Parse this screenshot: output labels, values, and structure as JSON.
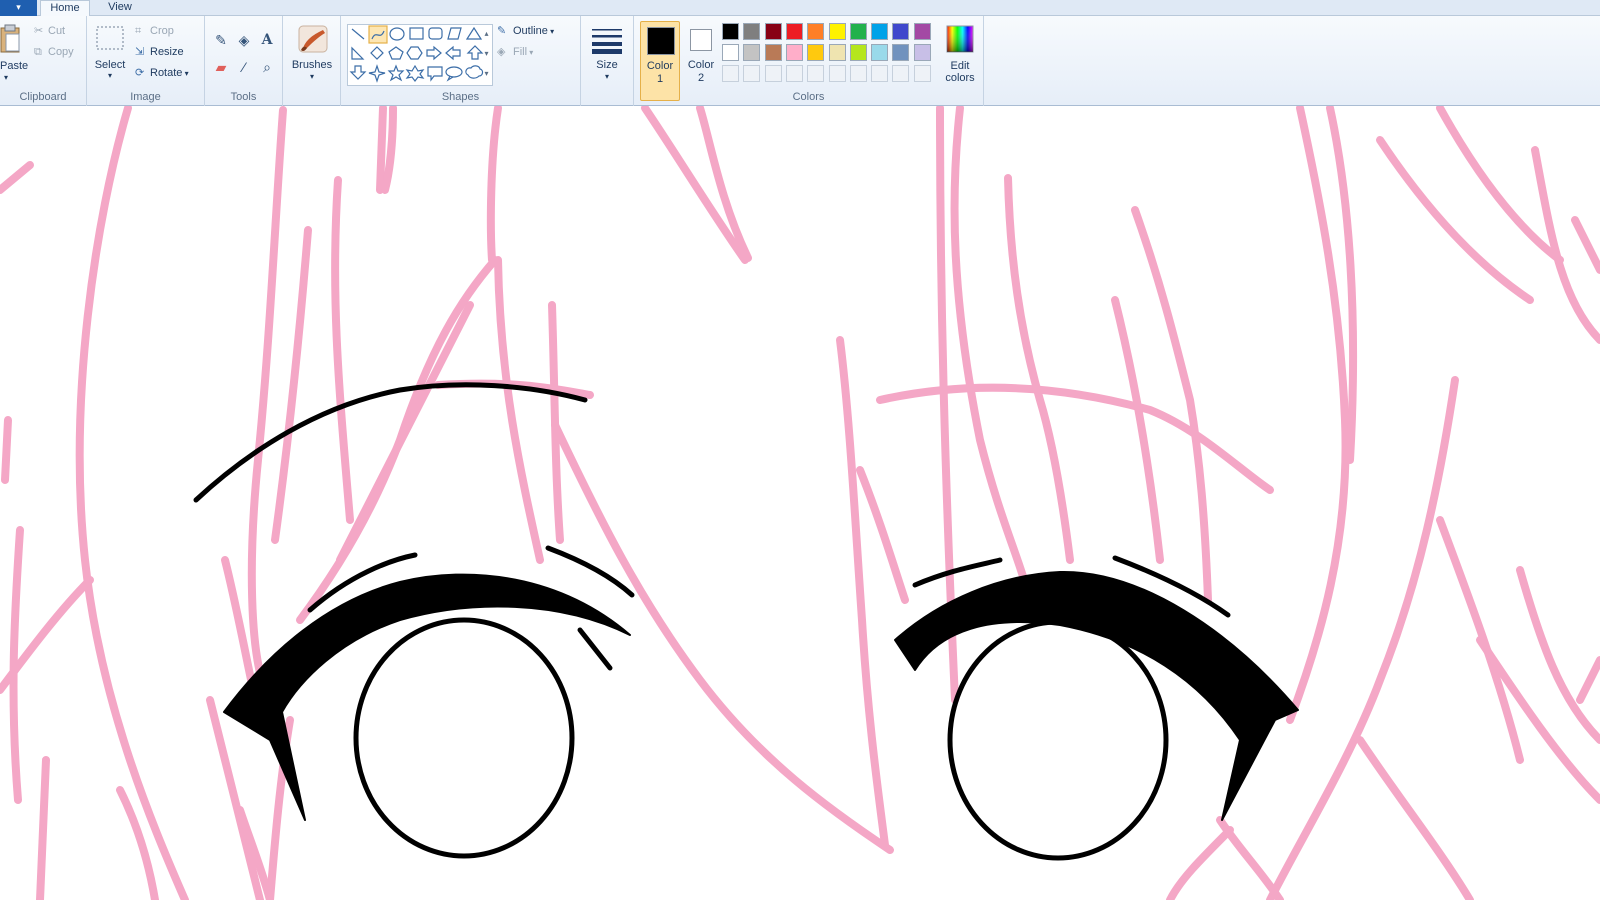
{
  "tabs": {
    "file_label": "▾",
    "home": "Home",
    "view": "View"
  },
  "clipboard": {
    "paste": "Paste",
    "cut": "Cut",
    "copy": "Copy",
    "group": "Clipboard"
  },
  "image": {
    "select": "Select",
    "crop": "Crop",
    "resize": "Resize",
    "rotate": "Rotate",
    "group": "Image"
  },
  "tools": {
    "group": "Tools",
    "icons": [
      "pencil-icon",
      "fill-icon",
      "text-icon",
      "eraser-icon",
      "color-picker-icon",
      "magnifier-icon"
    ]
  },
  "brushes": {
    "label": "Brushes"
  },
  "shapes": {
    "group": "Shapes",
    "outline": "Outline",
    "fill": "Fill"
  },
  "size": {
    "label": "Size"
  },
  "color1": {
    "label": "Color",
    "sub": "1",
    "value": "#000000"
  },
  "color2": {
    "label": "Color",
    "sub": "2",
    "value": "#ffffff"
  },
  "colors": {
    "group": "Colors",
    "edit": "Edit",
    "edit_sub": "colors",
    "row1": [
      "#000000",
      "#7f7f7f",
      "#880015",
      "#ed1c24",
      "#ff7f27",
      "#fff200",
      "#22b14c",
      "#00a2e8",
      "#3f48cc",
      "#a349a4"
    ],
    "row2": [
      "#ffffff",
      "#c3c3c3",
      "#b97a57",
      "#ffaec9",
      "#ffc90e",
      "#efe4b0",
      "#b5e61d",
      "#99d9ea",
      "#7092be",
      "#c8bfe7"
    ]
  },
  "palette": {
    "sketch": "#f4a7c6",
    "ink": "#000000",
    "accent": "#1f5fb0"
  }
}
